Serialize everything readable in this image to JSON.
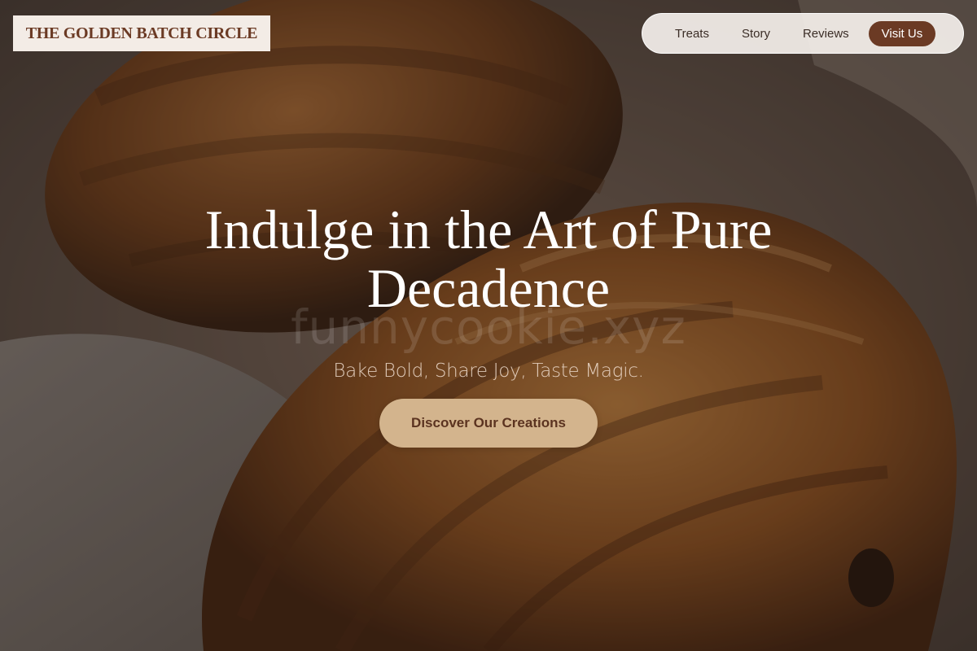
{
  "brand": {
    "name": "THE GOLDEN BATCH CIRCLE"
  },
  "nav": {
    "items": [
      {
        "label": "Treats"
      },
      {
        "label": "Story"
      },
      {
        "label": "Reviews"
      }
    ],
    "cta_label": "Visit Us"
  },
  "hero": {
    "headline": "Indulge in the Art of Pure Decadence",
    "watermark": "funnycookie.xyz",
    "tagline": "Bake Bold, Share Joy, Taste Magic.",
    "button_label": "Discover Our Creations",
    "background_image": "croissant-photo"
  },
  "colors": {
    "brand_brown": "#6b3a24",
    "button_tan": "#d3b48d",
    "logo_bg": "#f3ece6",
    "nav_bg": "#f5f0ec"
  }
}
